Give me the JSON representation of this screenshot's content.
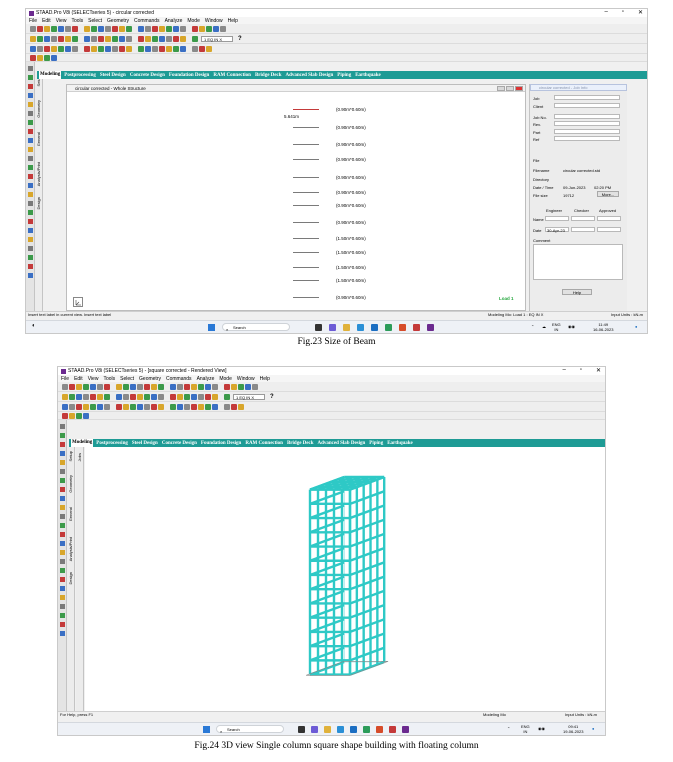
{
  "figure1": {
    "window_title": "STAAD.Pro V8i (SELECTseries 5) - circular corrected",
    "menu": [
      "File",
      "Edit",
      "View",
      "Tools",
      "Select",
      "Geometry",
      "Commands",
      "Analyze",
      "Mode",
      "Window",
      "Help"
    ],
    "load_combo": "1 EQ IN X",
    "tabs": [
      "Modeling",
      "Postprocessing",
      "Steel Design",
      "Concrete Design",
      "Foundation Design",
      "RAM Connection",
      "Bridge Deck",
      "Advanced Slab Design",
      "Piping",
      "Earthquake"
    ],
    "side_tabs": [
      "Setup",
      "Geometry",
      "General",
      "Analysis/Print",
      "Design"
    ],
    "viewport_title": "circular corrected - Whole Structure",
    "dimension_label": "5.641m",
    "beam_labels": [
      "(0.90m*0.60m)",
      "(0.90m*0.60m)",
      "(0.90m*0.60m)",
      "(0.90m*0.60m)",
      "(0.90m*0.60m)",
      "(0.90m*0.60m)",
      "(0.90m*0.60m)",
      "(0.90m*0.60m)",
      "(1.50m*0.60m)",
      "(1.50m*0.60m)",
      "(1.50m*0.60m)",
      "(1.50m*0.60m)",
      "(0.90m*0.60m)"
    ],
    "load_label": "Load 1",
    "job_panel": {
      "title": "circular corrected - Job Info",
      "fields": [
        "Job",
        "Client",
        "Job No.",
        "Rev.",
        "Part",
        "Ref"
      ],
      "file_section": "File",
      "filename_label": "Filename",
      "filename": "circular corrected.std",
      "directory_label": "Directory",
      "datetime_label": "Date / Time",
      "date": "09-Jun-2023",
      "time": "02:20 PM",
      "filesize_label": "File size",
      "filesize": "19712",
      "more_button": "More...",
      "roles": [
        "Engineer",
        "Checker",
        "Approved"
      ],
      "name_label": "Name",
      "date_label": "Date",
      "eng_date": "30-Apr-23",
      "comment_label": "Comment",
      "help_button": "Help"
    },
    "status_left": "Insert text label in current view. Insert text label",
    "status_mode": "Modeling Mo: Load 1 : EQ IN X",
    "status_units": "Input Units : kN-m",
    "taskbar": {
      "search": "Search",
      "lang": "ENG",
      "region": "IN",
      "time": "11:49",
      "date": "16-06-2023"
    },
    "caption": "Fig.23 Size of Beam"
  },
  "figure2": {
    "window_title": "STAAD.Pro V8i (SELECTseries 5) - [square corrected - Rendered View]",
    "menu": [
      "File",
      "Edit",
      "View",
      "Tools",
      "Select",
      "Geometry",
      "Commands",
      "Analyze",
      "Mode",
      "Window",
      "Help"
    ],
    "load_combo": "1 EQ IN X",
    "tabs": [
      "Modeling",
      "Postprocessing",
      "Steel Design",
      "Concrete Design",
      "Foundation Design",
      "RAM Connection",
      "Bridge Deck",
      "Advanced Slab Design",
      "Piping",
      "Earthquake"
    ],
    "side_tabs": [
      "Setup",
      "Geometry",
      "General",
      "Analysis/Print",
      "Design"
    ],
    "jobs_tab": "Jobs",
    "status_left": "For Help, press F1",
    "status_mode": "Modeling Mo",
    "status_units": "Input Units : kN-m",
    "taskbar": {
      "search": "Search",
      "lang": "ENG",
      "region": "IN",
      "time": "09:41",
      "date": "19-06-2023"
    },
    "caption": "Fig.24 3D view Single column square shape building with floating column"
  },
  "colors": {
    "tab_bar": "#1e9b95",
    "render_fill": "#2ec9c6",
    "load_text": "#22a63b"
  }
}
